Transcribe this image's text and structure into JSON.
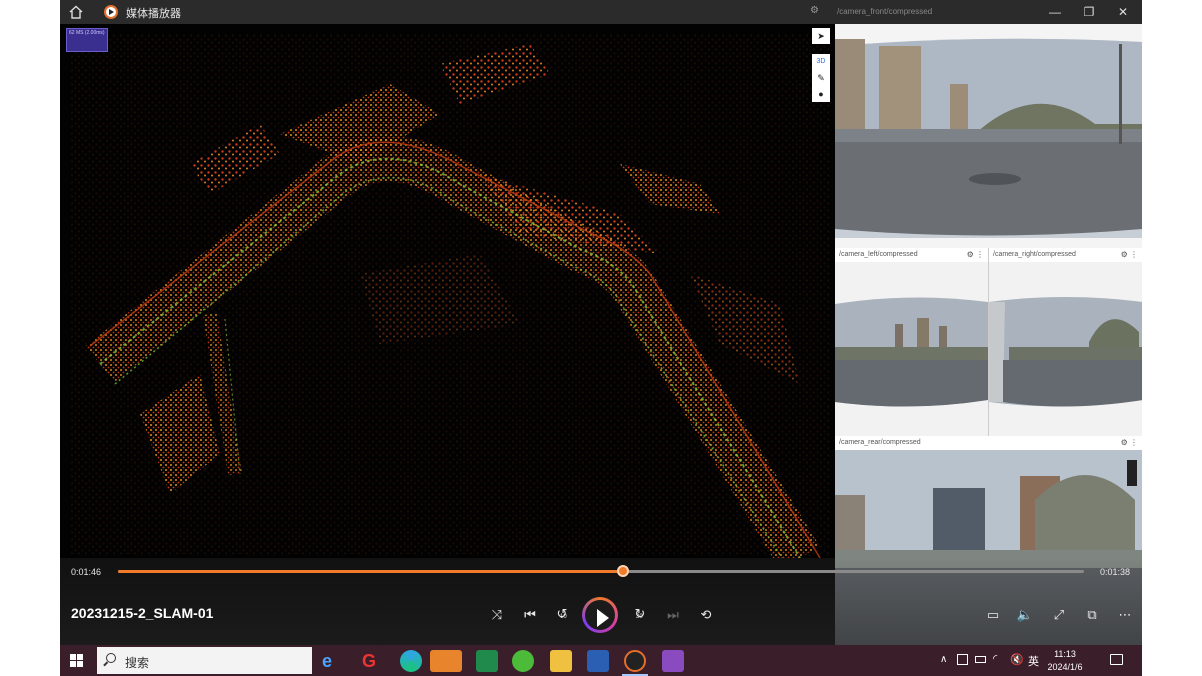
{
  "window": {
    "title": "媒体播放器",
    "icons": {
      "home": "home-icon",
      "logo": "media-player-logo-icon"
    },
    "front_topic": "/camera_front/compressed"
  },
  "map": {
    "perf_label": "62 MS (2.00ms)",
    "tools": {
      "select": "pointer-icon",
      "view_mode": "3D",
      "ruler": "ruler-icon",
      "publish": "point-icon"
    }
  },
  "cameras": {
    "left": {
      "topic": "/camera_left/compressed"
    },
    "right": {
      "topic": "/camera_right/compressed"
    },
    "rear": {
      "topic": "/camera_rear/compressed"
    },
    "gear_glyph": "⚙",
    "menu_glyph": "⋮"
  },
  "player": {
    "elapsed": "0:01:46",
    "remaining": "0:01:38",
    "progress": 0.523,
    "file_name": "20231215-2_SLAM-01",
    "skip_back": "10",
    "skip_forward": "30",
    "colors": {
      "accent": "#f07b2a"
    }
  },
  "taskbar": {
    "search_text": "搜索",
    "ime": "英",
    "time": "11:13",
    "date": "2024/1/6"
  }
}
